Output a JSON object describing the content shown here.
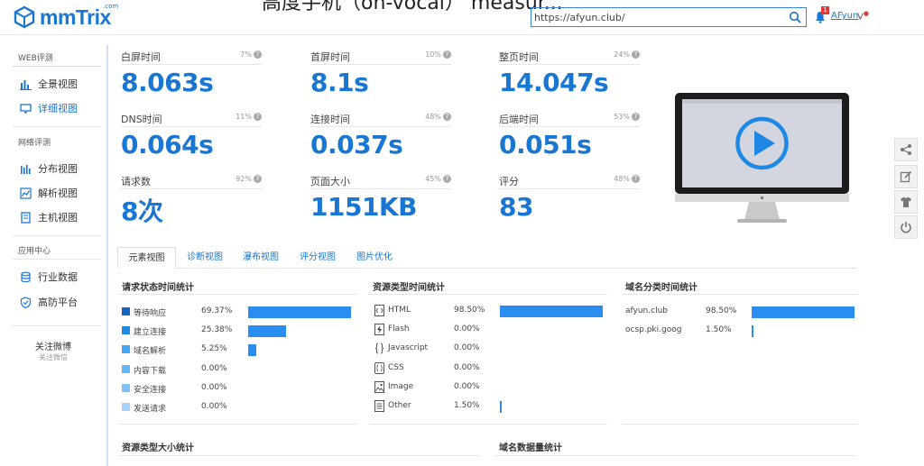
{
  "header": {
    "logo_text": "mmTrix",
    "logo_com": ".com",
    "title_cut": "高度手机（on-vocal）  measur...",
    "url_value": "https://afyun.club/",
    "notify_count": "1",
    "username": "AFyun",
    "vip": "V",
    "vip_mark": "●"
  },
  "sidebar": {
    "sec1": "WEB评测",
    "item1": "全景视图",
    "item2": "详细视图",
    "sec2": "网络评测",
    "item3": "分布视图",
    "item4": "解析视图",
    "item5": "主机视图",
    "sec3": "应用中心",
    "item6": "行业数据",
    "item7": "高防平台",
    "follow": "关注微博",
    "follow_sub": "关注微信"
  },
  "metrics": [
    {
      "label": "白屏时间",
      "pct": "7%",
      "value": "8.063s"
    },
    {
      "label": "首屏时间",
      "pct": "10%",
      "value": "8.1s"
    },
    {
      "label": "整页时间",
      "pct": "24%",
      "value": "14.047s"
    },
    {
      "label": "DNS时间",
      "pct": "11%",
      "value": "0.064s"
    },
    {
      "label": "连接时间",
      "pct": "48%",
      "value": "0.037s"
    },
    {
      "label": "后端时间",
      "pct": "53%",
      "value": "0.051s"
    },
    {
      "label": "请求数",
      "pct": "92%",
      "value": "8次"
    },
    {
      "label": "页面大小",
      "pct": "45%",
      "value": "1151KB"
    },
    {
      "label": "评分",
      "pct": "48%",
      "value": "83"
    }
  ],
  "tabs": [
    "元素视图",
    "诊断视图",
    "瀑布视图",
    "评分视图",
    "图片优化"
  ],
  "panels": {
    "status_title": "请求状态时间统计",
    "status_rows": [
      {
        "name": "等待响应",
        "pct": "69.37%",
        "frac": 0.6937,
        "color": "#1565c0"
      },
      {
        "name": "建立连接",
        "pct": "25.38%",
        "frac": 0.2538,
        "color": "#1e88e5"
      },
      {
        "name": "域名解析",
        "pct": "5.25%",
        "frac": 0.0525,
        "color": "#42a5f5"
      },
      {
        "name": "内容下载",
        "pct": "0.00%",
        "frac": 0,
        "color": "#64b5f6"
      },
      {
        "name": "安全连接",
        "pct": "0.00%",
        "frac": 0,
        "color": "#82c1f7"
      },
      {
        "name": "发送请求",
        "pct": "0.00%",
        "frac": 0,
        "color": "#a6d2fa"
      }
    ],
    "type_title": "资源类型时间统计",
    "type_rows": [
      {
        "name": "HTML",
        "icon": "html-icon",
        "pct": "98.50%",
        "frac": 0.985
      },
      {
        "name": "Flash",
        "icon": "flash-icon",
        "pct": "0.00%",
        "frac": 0
      },
      {
        "name": "Javascript",
        "icon": "javascript-icon",
        "pct": "0.00%",
        "frac": 0
      },
      {
        "name": "CSS",
        "icon": "css-icon",
        "pct": "0.00%",
        "frac": 0
      },
      {
        "name": "Image",
        "icon": "image-icon",
        "pct": "0.00%",
        "frac": 0
      },
      {
        "name": "Other",
        "icon": "other-icon",
        "pct": "1.50%",
        "frac": 0.015
      }
    ],
    "domain_title": "域名分类时间统计",
    "domain_rows": [
      {
        "name": "afyun.club",
        "pct": "98.50%",
        "frac": 0.985
      },
      {
        "name": "ocsp.pki.goog",
        "pct": "1.50%",
        "frac": 0.015
      }
    ],
    "size_title": "资源类型大小统计",
    "domain_count_title": "域名数据量统计"
  },
  "colors": {
    "accent": "#1976d2",
    "bar": "#2a8ef0"
  }
}
